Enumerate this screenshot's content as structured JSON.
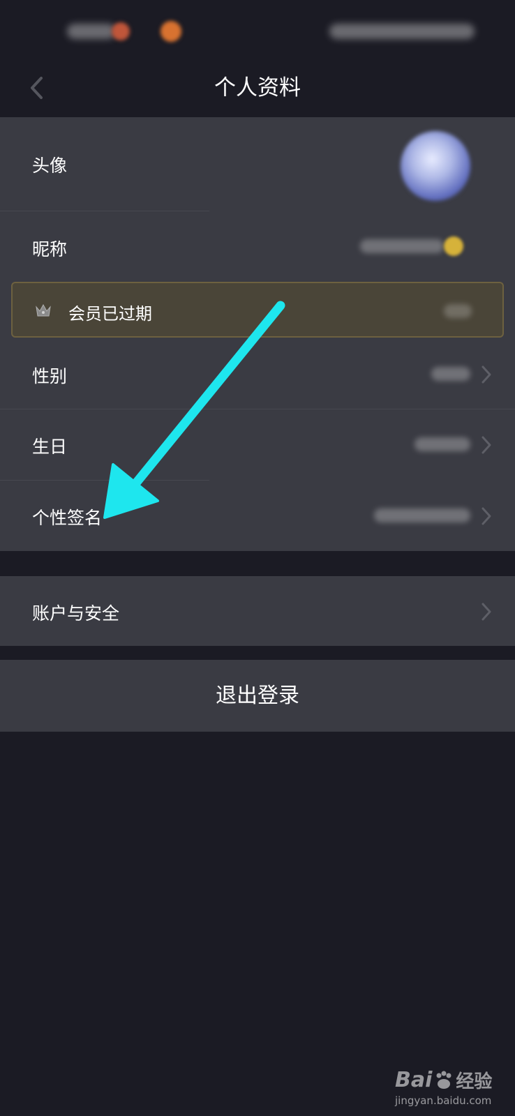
{
  "header": {
    "title": "个人资料"
  },
  "profile": {
    "avatar_label": "头像",
    "nickname_label": "昵称",
    "membership_label": "会员已过期",
    "gender_label": "性别",
    "birthday_label": "生日",
    "signature_label": "个性签名"
  },
  "account": {
    "security_label": "账户与安全"
  },
  "logout": {
    "label": "退出登录"
  },
  "annotation": {
    "arrow_color": "#1ee6ee"
  },
  "watermark": {
    "brand": "Bai",
    "brand2": "经验",
    "url": "jingyan.baidu.com"
  }
}
